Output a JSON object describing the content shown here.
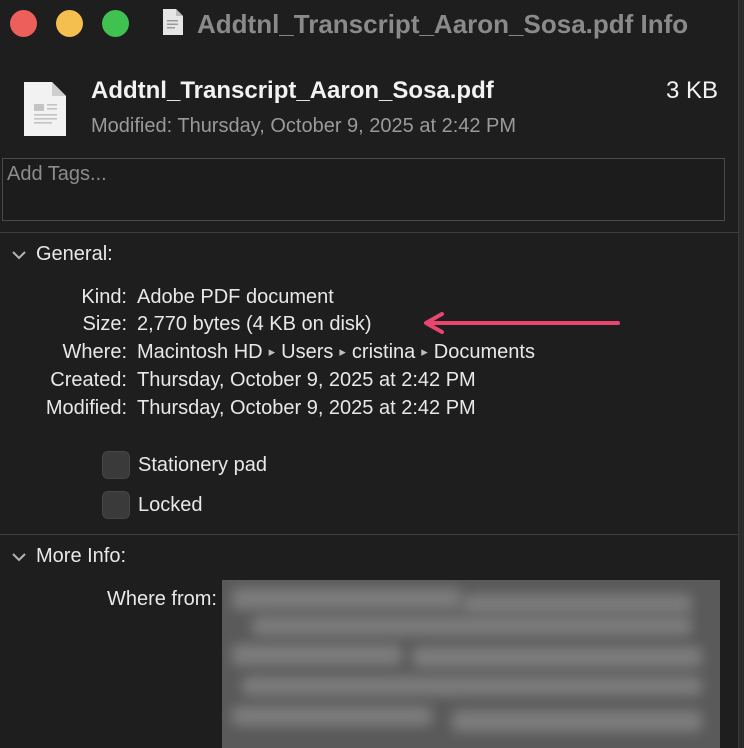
{
  "window": {
    "title": "Addtnl_Transcript_Aaron_Sosa.pdf Info"
  },
  "header": {
    "file_name": "Addtnl_Transcript_Aaron_Sosa.pdf",
    "file_size": "3 KB",
    "modified": "Modified: Thursday, October 9, 2025 at 2:42 PM"
  },
  "tags": {
    "placeholder": "Add Tags..."
  },
  "general": {
    "heading": "General:",
    "rows": [
      {
        "label": "Kind:",
        "value": "Adobe PDF document"
      },
      {
        "label": "Size:",
        "value": "2,770 bytes (4 KB on disk)"
      },
      {
        "label": "Where:",
        "path": [
          "Macintosh HD",
          "Users",
          "cristina",
          "Documents"
        ]
      },
      {
        "label": "Created:",
        "value": "Thursday, October 9, 2025 at 2:42 PM"
      },
      {
        "label": "Modified:",
        "value": "Thursday, October 9, 2025 at 2:42 PM"
      }
    ],
    "checkboxes": [
      {
        "label": "Stationery pad",
        "checked": false
      },
      {
        "label": "Locked",
        "checked": false
      }
    ]
  },
  "more_info": {
    "heading": "More Info:",
    "where_from_label": "Where from:"
  },
  "annotation": {
    "arrow_color": "#e8456f"
  },
  "colors": {
    "close": "#ec5f5b",
    "minimize": "#f4bf4f",
    "maximize": "#3fc24f"
  }
}
